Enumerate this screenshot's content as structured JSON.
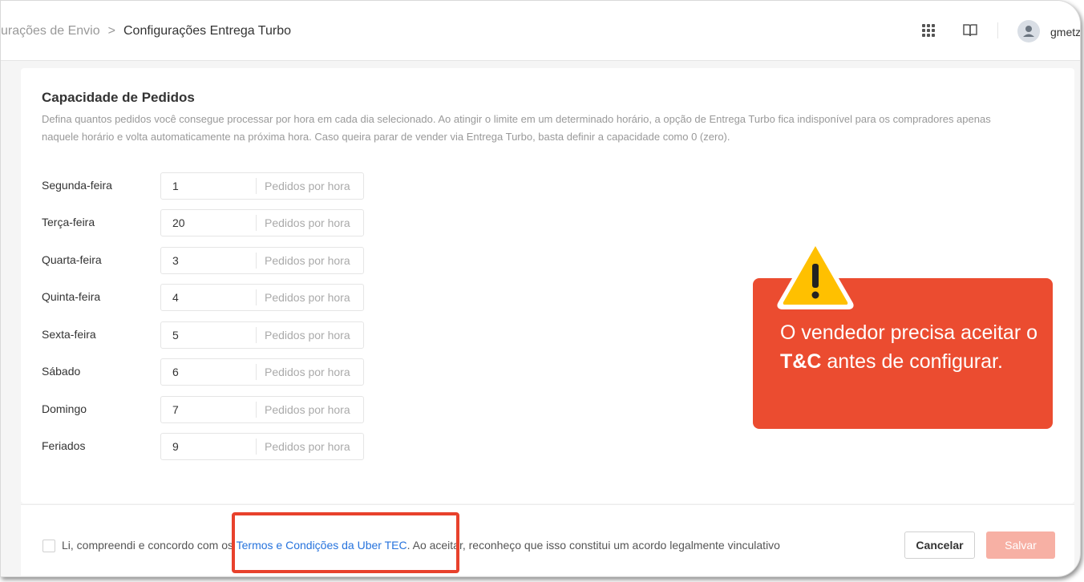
{
  "header": {
    "breadcrumb_prev": "urações de Envio",
    "breadcrumb_separator": ">",
    "breadcrumb_current": "Configurações Entrega Turbo",
    "apps_icon": "apps-grid-icon",
    "help_icon": "book-icon",
    "username": "gmetz"
  },
  "capacity": {
    "title": "Capacidade de Pedidos",
    "description": "Defina quantos pedidos você consegue processar por hora em cada dia selecionado. Ao atingir o limite em um determinado horário, a opção de Entrega Turbo fica indisponível para os compradores apenas naquele horário e volta automaticamente na próxima hora. Caso queira parar de vender via Entrega Turbo, basta definir a capacidade como 0 (zero).",
    "unit_label": "Pedidos por hora",
    "days": [
      {
        "label": "Segunda-feira",
        "value": "1"
      },
      {
        "label": "Terça-feira",
        "value": "20"
      },
      {
        "label": "Quarta-feira",
        "value": "3"
      },
      {
        "label": "Quinta-feira",
        "value": "4"
      },
      {
        "label": "Sexta-feira",
        "value": "5"
      },
      {
        "label": "Sábado",
        "value": "6"
      },
      {
        "label": "Domingo",
        "value": "7"
      },
      {
        "label": "Feriados",
        "value": "9"
      }
    ]
  },
  "footer": {
    "agree_prefix": "Li, compreendi e concordo com os ",
    "terms_link": "Termos e Condições da Uber TEC",
    "agree_suffix": ". Ao aceitar, reconheço que isso constitui um acordo legalmente vinculativo",
    "cancel_label": "Cancelar",
    "save_label": "Salvar"
  },
  "callout": {
    "text_before": "O vendedor precisa aceitar o ",
    "text_bold": "T&C",
    "text_after": " antes de configurar.",
    "icon": "warning-icon"
  },
  "colors": {
    "accent": "#eb4c30",
    "link": "#2673dd",
    "save_disabled": "#f7b0a4"
  }
}
